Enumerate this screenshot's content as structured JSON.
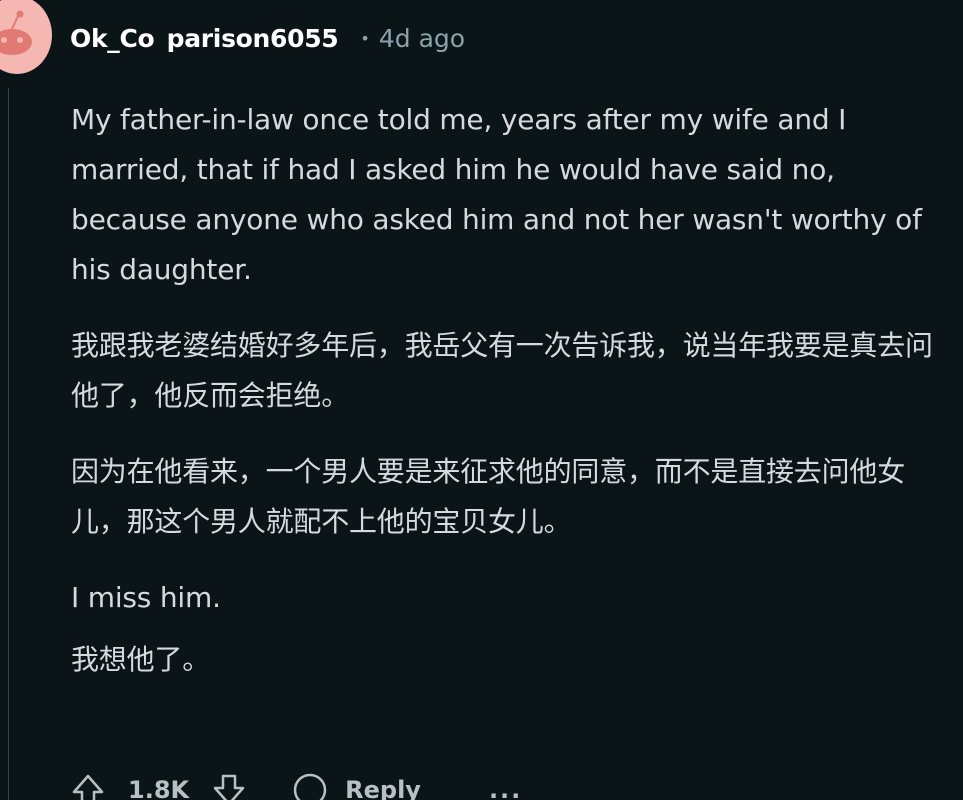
{
  "comment": {
    "author": "Ok_Co parison6055",
    "separator": "•",
    "timestamp": "4d ago",
    "paragraphs": [
      "My father-in-law once told me, years after my wife and I married, that if had I asked him he would have said no, because anyone who asked him and not her wasn't worthy of his daughter.",
      "我跟我老婆结婚好多年后，我岳父有一次告诉我，说当年我要是真去问他了，他反而会拒绝。",
      "因为在他看来，一个男人要是来征求他的同意，而不是直接去问他女儿，那这个男人就配不上他的宝贝女儿。",
      "I miss him.",
      "我想他了。"
    ]
  },
  "actions": {
    "upvote_icon": "upvote-arrow-icon",
    "vote_count": "1.8K",
    "downvote_icon": "downvote-arrow-icon",
    "reply_icon": "comment-bubble-icon",
    "reply_label": "Reply",
    "more_label": "..."
  },
  "colors": {
    "background": "#0b1416",
    "text": "#d7dadc",
    "meta": "#8ba2ad",
    "avatar": "#f5b7b1"
  }
}
